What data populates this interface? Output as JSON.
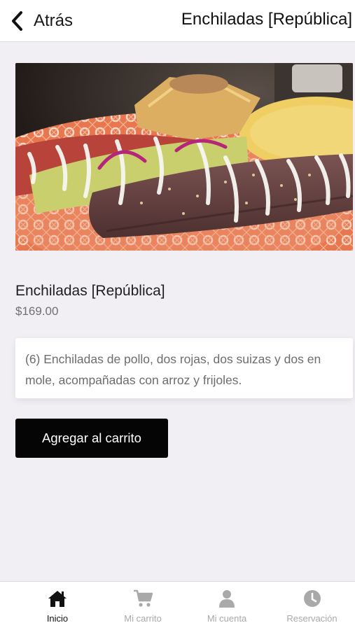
{
  "header": {
    "back_label": "Atrás",
    "title": "Enchiladas [República]"
  },
  "product": {
    "image_subject": "enchiladas plate",
    "name": "Enchiladas [República]",
    "price": "$169.00",
    "description": "(6) Enchiladas de pollo, dos rojas, dos suizas y dos en mole, acompañadas con arroz y frijoles.",
    "add_to_cart_label": "Agregar al carrito"
  },
  "bottom_nav": {
    "items": [
      {
        "label": "Inicio",
        "icon": "home-icon",
        "active": true
      },
      {
        "label": "Mi carrito",
        "icon": "cart-icon",
        "active": false
      },
      {
        "label": "Mi cuenta",
        "icon": "user-icon",
        "active": false
      },
      {
        "label": "Reservación",
        "icon": "clock-icon",
        "active": false
      }
    ]
  },
  "colors": {
    "background": "#f1eff3",
    "button": "#050505",
    "nav_active": "#111111",
    "nav_inactive": "#a9a9a9"
  }
}
